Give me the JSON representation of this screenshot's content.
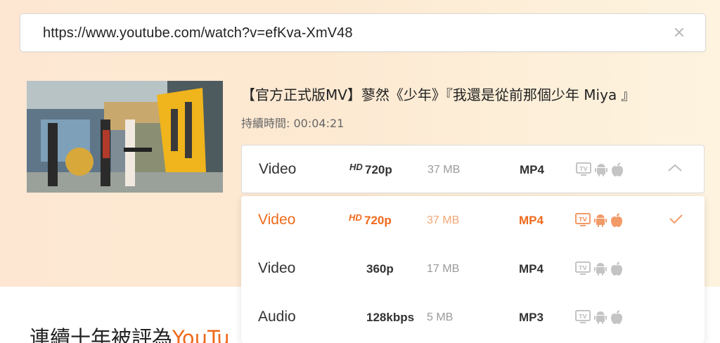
{
  "url_bar": {
    "value": "https://www.youtube.com/watch?v=efKva-XmV48",
    "clear_glyph": "×"
  },
  "video": {
    "title": "【官方正式版MV】蓼然《少年》『我還是從前那個少年 Miya 』",
    "duration": "持續時間: 00:04:21",
    "thumbnail_icon": "video-thumbnail"
  },
  "selector": {
    "type": "Video",
    "hd": "HD",
    "resolution": "720p",
    "size": "37 MB",
    "format": "MP4",
    "expanded": true
  },
  "options": [
    {
      "type": "Video",
      "hd": "HD",
      "resolution": "720p",
      "size": "37 MB",
      "format": "MP4",
      "selected": true
    },
    {
      "type": "Video",
      "hd": "",
      "resolution": "360p",
      "size": "17 MB",
      "format": "MP4",
      "selected": false
    },
    {
      "type": "Audio",
      "hd": "",
      "resolution": "128kbps",
      "size": "5 MB",
      "format": "MP3",
      "selected": false
    }
  ],
  "device_icons": [
    "tv-icon",
    "android-icon",
    "apple-icon"
  ],
  "tagline": {
    "text": "連續十年被評為",
    "accent": "YouTu"
  },
  "colors": {
    "accent": "#ef6a1c",
    "icon_gray": "#c4c4c4",
    "icon_accent": "#f29a68"
  }
}
